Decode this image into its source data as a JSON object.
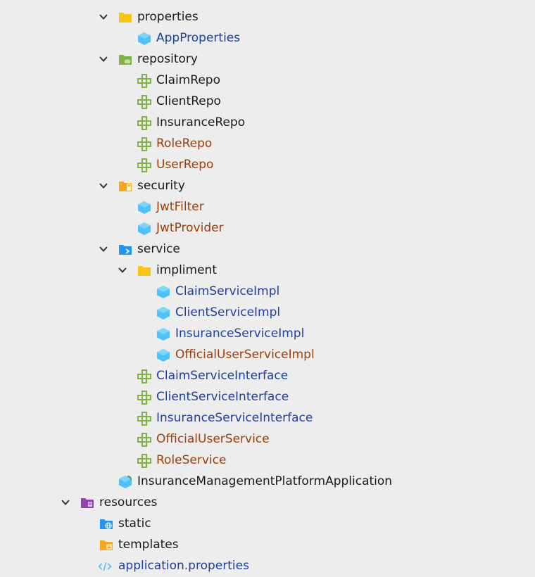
{
  "colors": {
    "background": "#ededed",
    "default_text": "#1a1a1a",
    "class_blue": "#1f3f9e",
    "modified_orange": "#9a3e0c",
    "folder_yellow": "#f5c518",
    "repo_green": "#7cb342",
    "service_blue": "#2196f3",
    "resources_purple": "#8e44ad",
    "class_cyan": "#4fc3f7"
  },
  "tree": {
    "nodes": [
      {
        "label": "properties",
        "icon": "folder-icon",
        "color": "default",
        "expanded": true
      },
      {
        "label": "AppProperties",
        "icon": "class-icon",
        "color": "blue"
      },
      {
        "label": "repository",
        "icon": "repository-folder-icon",
        "color": "default",
        "expanded": true
      },
      {
        "label": "ClaimRepo",
        "icon": "interface-icon",
        "color": "default"
      },
      {
        "label": "ClientRepo",
        "icon": "interface-icon",
        "color": "default"
      },
      {
        "label": "InsuranceRepo",
        "icon": "interface-icon",
        "color": "default"
      },
      {
        "label": "RoleRepo",
        "icon": "interface-icon",
        "color": "orange"
      },
      {
        "label": "UserRepo",
        "icon": "interface-icon",
        "color": "orange"
      },
      {
        "label": "security",
        "icon": "security-folder-icon",
        "color": "default",
        "expanded": true
      },
      {
        "label": "JwtFilter",
        "icon": "class-icon",
        "color": "orange"
      },
      {
        "label": "JwtProvider",
        "icon": "class-icon",
        "color": "orange"
      },
      {
        "label": "service",
        "icon": "service-folder-icon",
        "color": "default",
        "expanded": true
      },
      {
        "label": "impliment",
        "icon": "folder-icon",
        "color": "default",
        "expanded": true
      },
      {
        "label": "ClaimServiceImpl",
        "icon": "class-icon",
        "color": "blue"
      },
      {
        "label": "ClientServiceImpl",
        "icon": "class-icon",
        "color": "blue"
      },
      {
        "label": "InsuranceServiceImpl",
        "icon": "class-icon",
        "color": "blue"
      },
      {
        "label": "OfficialUserServiceImpl",
        "icon": "class-icon",
        "color": "orange"
      },
      {
        "label": "ClaimServiceInterface",
        "icon": "interface-icon",
        "color": "blue"
      },
      {
        "label": "ClientServiceInterface",
        "icon": "interface-icon",
        "color": "blue"
      },
      {
        "label": "InsuranceServiceInterface",
        "icon": "interface-icon",
        "color": "blue"
      },
      {
        "label": "OfficialUserService",
        "icon": "interface-icon",
        "color": "orange"
      },
      {
        "label": "RoleService",
        "icon": "interface-icon",
        "color": "orange"
      },
      {
        "label": "InsuranceManagementPlatformApplication",
        "icon": "spring-app-class-icon",
        "color": "default"
      },
      {
        "label": "resources",
        "icon": "resources-folder-icon",
        "color": "default",
        "expanded": true
      },
      {
        "label": "static",
        "icon": "web-folder-icon",
        "color": "default"
      },
      {
        "label": "templates",
        "icon": "templates-folder-icon",
        "color": "default"
      },
      {
        "label": "application.properties",
        "icon": "properties-file-icon",
        "color": "blue"
      }
    ]
  }
}
